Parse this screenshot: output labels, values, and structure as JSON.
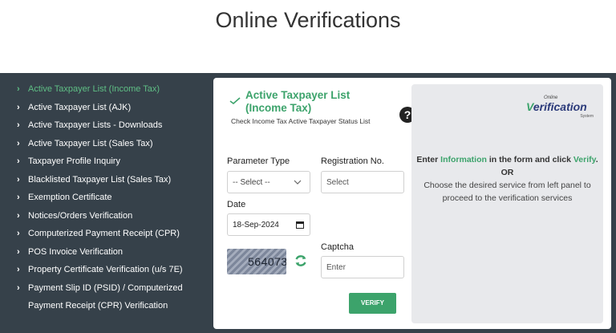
{
  "page": {
    "title": "Online Verifications"
  },
  "sidebar": {
    "items": [
      {
        "label": "Active Taxpayer List (Income Tax)",
        "active": true
      },
      {
        "label": "Active Taxpayer List (AJK)"
      },
      {
        "label": "Active Taxpayer Lists - Downloads"
      },
      {
        "label": "Active Taxpayer List (Sales Tax)"
      },
      {
        "label": "Taxpayer Profile Inquiry"
      },
      {
        "label": "Blacklisted Taxpayer List (Sales Tax)"
      },
      {
        "label": "Exemption Certificate"
      },
      {
        "label": "Notices/Orders Verification"
      },
      {
        "label": "Computerized Payment Receipt (CPR)"
      },
      {
        "label": "POS Invoice Verification"
      },
      {
        "label": "Property Certificate Verification (u/s 7E)"
      },
      {
        "label": "Payment Slip ID (PSID) / Computerized",
        "label2": "Payment Receipt (CPR) Verification"
      }
    ]
  },
  "form": {
    "title": "Active Taxpayer List (Income Tax)",
    "subtitle": "Check Income Tax Active Taxpayer Status List",
    "parameter_type_label": "Parameter Type",
    "parameter_type_value": "-- Select --",
    "registration_label": "Registration No.",
    "registration_placeholder": "Select",
    "date_label": "Date",
    "date_value": "18-Sep-2024",
    "captcha_label": "Captcha",
    "captcha_text": "564073",
    "captcha_placeholder": "Enter",
    "verify_label": "VERIFY",
    "help_symbol": "?"
  },
  "info": {
    "logo_online": "Online",
    "logo_main": "erification",
    "logo_v": "V",
    "logo_system": "System",
    "line1_a": "Enter ",
    "line1_hl1": "Information",
    "line1_b": " in the form and click ",
    "line1_hl2": "Verify",
    "line1_c": ".",
    "or": "OR",
    "line2": "Choose the desired service from left panel to proceed to the verification services"
  },
  "colors": {
    "accent": "#3ca36b",
    "sidebar_bg": "#36414a",
    "active_item": "#5fbf85"
  }
}
